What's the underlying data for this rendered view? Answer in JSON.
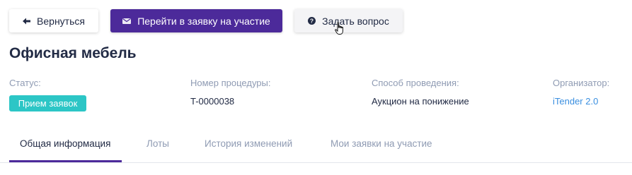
{
  "toolbar": {
    "back_label": "Вернуться",
    "apply_label": "Перейти в заявку на участие",
    "ask_label": "Задать вопрос",
    "back_icon": "arrow-left-icon",
    "apply_icon": "envelope-icon",
    "ask_icon": "question-circle-icon"
  },
  "page": {
    "title": "Офисная мебель"
  },
  "info": {
    "status_label": "Статус:",
    "status_value": "Прием заявок",
    "procedure_label": "Номер процедуры:",
    "procedure_value": "T-0000038",
    "method_label": "Способ проведения:",
    "method_value": "Аукцион на понижение",
    "organizer_label": "Организатор:",
    "organizer_value": "iTender 2.0"
  },
  "tabs": [
    {
      "label": "Общая информация",
      "active": true
    },
    {
      "label": "Лоты",
      "active": false
    },
    {
      "label": "История изменений",
      "active": false
    },
    {
      "label": "Мои заявки на участие",
      "active": false
    }
  ],
  "colors": {
    "accent": "#4c2a9a",
    "status": "#2cc6c6",
    "link": "#3a8fe0",
    "muted": "#8f9bb3",
    "text": "#222b45"
  }
}
